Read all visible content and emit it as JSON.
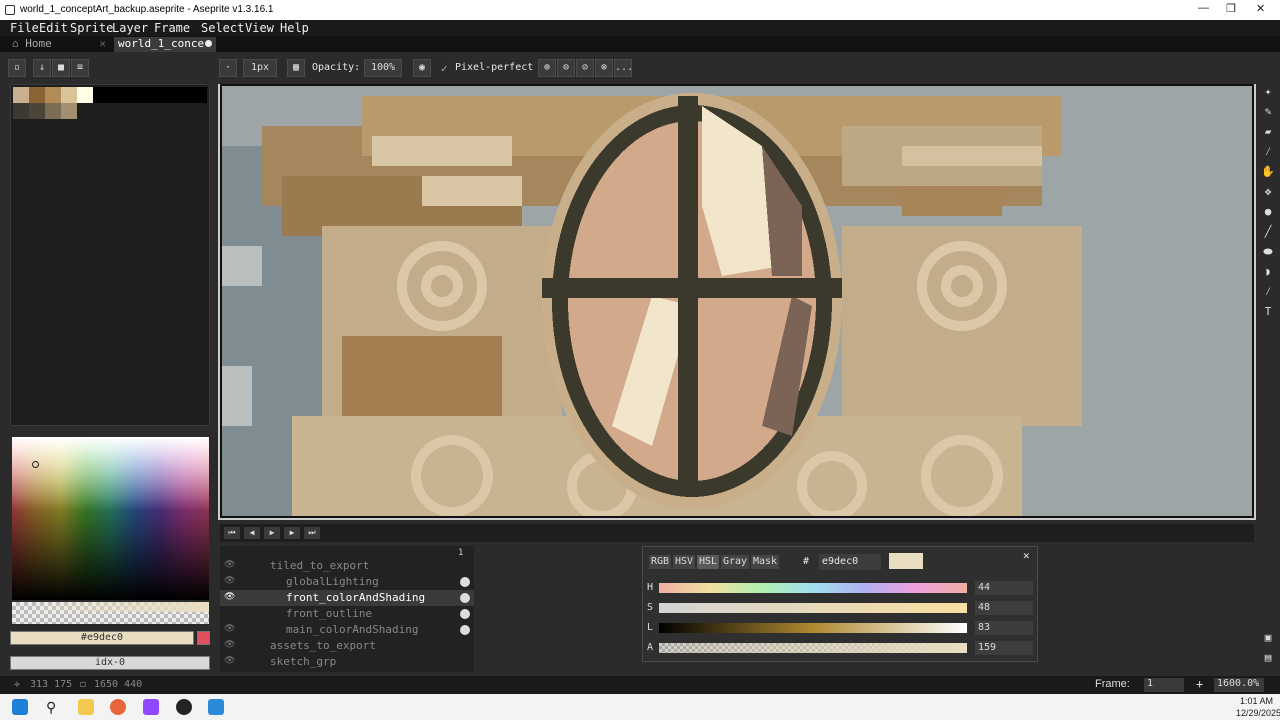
{
  "window": {
    "title": "world_1_conceptArt_backup.aseprite - Aseprite v1.3.16.1",
    "minimize": "—",
    "restore": "❐",
    "close": "✕"
  },
  "menu": [
    "File",
    "Edit",
    "Sprite",
    "Layer",
    "Frame",
    "Select",
    "View",
    "Help"
  ],
  "tabs": {
    "home": "Home",
    "file": "world_1_conce"
  },
  "toolbar": {
    "brush_size": "1px",
    "opacity_label": "Opacity:",
    "opacity_value": "100%",
    "pixel_perfect_label": "Pixel-perfect",
    "more": "..."
  },
  "layers": [
    {
      "name": "tiled_to_export",
      "active": false
    },
    {
      "name": "globalLighting",
      "active": false
    },
    {
      "name": "front_colorAndShading",
      "active": true
    },
    {
      "name": "front_outline",
      "active": false
    },
    {
      "name": "main_colorAndShading",
      "active": false
    },
    {
      "name": "assets_to_export",
      "active": false
    },
    {
      "name": "sketch_grp",
      "active": false
    }
  ],
  "frame_header": "1",
  "color_panel": {
    "modes": [
      "RGB",
      "HSV",
      "HSL",
      "Gray",
      "Mask"
    ],
    "active_mode": "HSL",
    "hash": "#",
    "hex": "e9dec0",
    "sliders": [
      {
        "label": "H",
        "value": "44"
      },
      {
        "label": "S",
        "value": "48"
      },
      {
        "label": "L",
        "value": "83"
      },
      {
        "label": "A",
        "value": "159"
      }
    ]
  },
  "fg_color": "#e9dec0",
  "index_field": "idx-0",
  "status": {
    "cursor": "313 175",
    "size": "1650 440",
    "frame_label": "Frame:",
    "frame_value": "1",
    "zoom": "1600.0%"
  },
  "clock": {
    "time": "1:01 AM",
    "date": "12/29/2025"
  },
  "colors": {
    "accent": "#e9dec0",
    "bg": "#2b2b2b",
    "outline": "#3a392c"
  }
}
